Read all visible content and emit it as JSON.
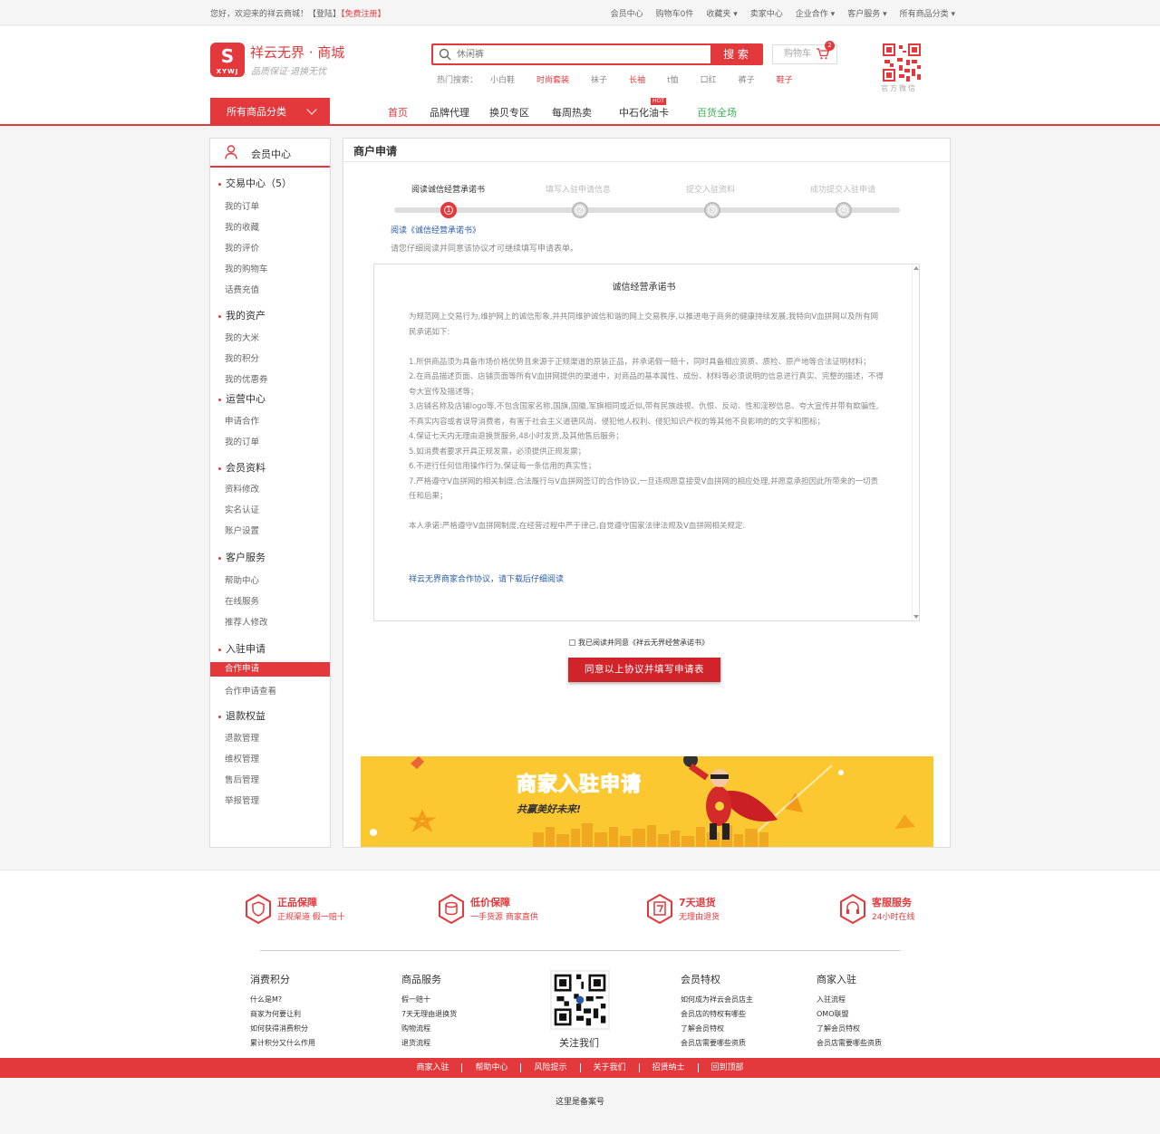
{
  "topbar": {
    "welcome": "您好，欢迎来的祥云商城！",
    "login": "【登陆】",
    "register": "【免费注册】",
    "links": [
      "会员中心",
      "购物车0件",
      "收藏夹",
      "卖家中心",
      "企业合作",
      "客户服务",
      "所有商品分类"
    ]
  },
  "header": {
    "logo_mark": "S",
    "logo_sub": "XYWJ",
    "logo_title": "祥云无界 · 商城",
    "logo_slogan": "品质保证·退换无忧",
    "search_placeholder": "休闲裤",
    "search_button": "搜 索",
    "hot_label": "热门搜索：",
    "hot_words": [
      "小白鞋",
      "时尚套装",
      "袜子",
      "长袖",
      "t恤",
      "口红",
      "裤子",
      "鞋子"
    ],
    "cart_label": "购物车",
    "cart_count": "2",
    "qr_label": "官方微信"
  },
  "nav": {
    "all_categories": "所有商品分类",
    "items": [
      "首页",
      "品牌代理",
      "换贝专区",
      "每周热卖",
      "中石化油卡",
      "百货全场"
    ],
    "hot_badge": "HOT"
  },
  "sidebar": {
    "title": "会员中心",
    "sections": [
      {
        "title": "交易中心（5）",
        "items": [
          "我的订单",
          "我的收藏",
          "我的评价",
          "我的购物车",
          "话费充值"
        ]
      },
      {
        "title": "我的资产",
        "items": [
          "我的大米",
          "我的积分",
          "我的优惠券"
        ]
      },
      {
        "title": "运营中心",
        "items": [
          "申请合作",
          "我的订单"
        ]
      },
      {
        "title": "会员资料",
        "items": [
          "资料修改",
          "实名认证",
          "账户设置"
        ]
      },
      {
        "title": "客户服务",
        "items": [
          "帮助中心",
          "在线服务",
          "推荐人修改"
        ]
      },
      {
        "title": "入驻申请",
        "items": [
          "合作申请",
          "合作申请查看"
        ]
      },
      {
        "title": "退款权益",
        "items": [
          "退款管理",
          "维权管理",
          "售后管理",
          "举报管理"
        ]
      }
    ]
  },
  "main": {
    "title": "商户申请",
    "steps": [
      {
        "label": "阅读诚信经营承诺书",
        "num": "1"
      },
      {
        "label": "填写入驻申请信息",
        "num": "2"
      },
      {
        "label": "提交入驻资料",
        "num": "3"
      },
      {
        "label": "成功提交入驻申请",
        "num": "4"
      }
    ],
    "read_link": "阅读《诚信经营承诺书》",
    "read_note": "请您仔细阅读并同意该协议才可继续填写申请表单。",
    "doc_title": "诚信经营承诺书",
    "doc_paragraphs": [
      "为规范网上交易行为,维护网上的诚信形象,并共同维护诚信和谐的网上交易秩序,以推进电子商务的健康持续发展,我特向V血拼网以及所有网民承诺如下:",
      "",
      "1.所供商品须为具备市场价格优势且来源于正规渠道的原装正品，并承诺假一赔十，同时具备相应资质、质检、原产地等合法证明材料；",
      "2.在商品描述页面、店铺页面等所有V血拼网提供的渠道中，对商品的基本属性、成份、材料等必须说明的信息进行真实、完整的描述，不得夸大宣传及描述等；",
      "3.店铺名称及店铺logo等,不包含国家名称,国旗,国徽,军旗相同或近似,带有民族歧视、仇恨、反动、性和淫秽信息、夸大宣传并带有欺骗性,不真实内容或者误导消费者，有害于社会主义道德风尚、侵犯他人权利、侵犯知识产权的等其他不良影响的的文字和图标；",
      "4.保证七天内无理由退换货服务,48小时发货,及其他售后服务；",
      "5.如消费者要求开具正规发票，必须提供正规发票；",
      "6.不进行任何信用操作行为,保证每一条信用的真实性；",
      "7.严格遵守V血拼网的相关制度,合法履行与V血拼网签订的合作协议,一旦违规愿意接受V血拼网的相应处理,并愿意承担因此所带来的一切责任和后果；",
      "",
      "本人承诺:严格遵守V血拼网制度,在经营过程中严于律己,自觉遵守国家法律法规及V血拼网相关规定."
    ],
    "doc_link": "祥云无界商家合作协议，请下载后仔细阅读",
    "agree_text": "我已阅读并同意《祥云无界经营承诺书》",
    "agree_button": "同意以上协议并填写申请表",
    "banner_title": "商家入驻申请",
    "banner_sub": "共赢美好未来!"
  },
  "footer": {
    "features": [
      {
        "title": "正品保障",
        "sub": "正规渠道  假一赔十"
      },
      {
        "title": "低价保障",
        "sub": "一手货源  商家直供"
      },
      {
        "title": "7天退货",
        "sub": "无理由退货"
      },
      {
        "title": "客服服务",
        "sub": "24小时在线"
      }
    ],
    "columns": [
      {
        "title": "消费积分",
        "items": [
          "什么是M?",
          "商家为何要让利",
          "如何获得消费积分",
          "累计积分又什么作用"
        ]
      },
      {
        "title": "商品服务",
        "items": [
          "假一赔十",
          "7天无理由退换货",
          "购物流程",
          "退货流程"
        ]
      },
      {
        "title": "会员特权",
        "items": [
          "如何成为祥云会员店主",
          "会员店的特权有哪些",
          "了解会员特权",
          "会员店需要哪些资质"
        ]
      },
      {
        "title": "商家入驻",
        "items": [
          "入驻流程",
          "OMO联盟",
          "了解会员特权",
          "会员店需要哪些资质"
        ]
      }
    ],
    "qr_label": "关注我们",
    "bar_links": [
      "商家入驻",
      "帮助中心",
      "风险提示",
      "关于我们",
      "招贤纳士",
      "回到顶部"
    ],
    "icp": "这里是备案号"
  },
  "colors": {
    "accent": "#e4393c",
    "green": "#3cb054",
    "link": "#2a5ba7",
    "banner": "#fbc831"
  }
}
